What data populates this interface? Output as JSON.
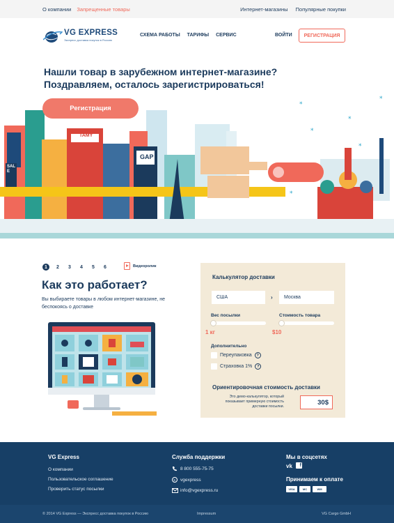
{
  "topbar": {
    "about": "О компании",
    "forbidden": "Запрещенные товары",
    "shops": "Интернет-магазины",
    "popular": "Популярные покупки"
  },
  "header": {
    "logo_title": "VG EXPRESS",
    "logo_subtitle": "Экспресс доставка покупок в Россию",
    "nav": [
      "СХЕМА РАБОТЫ",
      "ТАРИФЫ",
      "СЕРВИС"
    ],
    "login": "ВОЙТИ",
    "register": "РЕГИСТРАЦИЯ"
  },
  "hero": {
    "title_line1": "Нашли товар в зарубежном интернет-магазине?",
    "title_line2": "Поздравляем, осталось зарегистрироваться!",
    "button": "Регистрация",
    "sign_sale": "SALE",
    "sign_gap": "GAP",
    "sign_tamy": "TAMY"
  },
  "how": {
    "steps": [
      "1",
      "2",
      "3",
      "4",
      "5",
      "6"
    ],
    "active_step": "1",
    "video_label": "Видеоролик",
    "title": "Как это работает?",
    "text": "Вы выбираете товары в любом интернет-магазине, не беспокоясь о доставке"
  },
  "calculator": {
    "title": "Калькулятор доставки",
    "from": "США",
    "to": "Москва",
    "weight_label": "Вес посылки",
    "weight_value": "1 кг",
    "weight_fraction": 0.0,
    "cost_label": "Стоимость товара",
    "cost_value": "$10",
    "cost_fraction": 0.0,
    "extra_label": "Дополнительно",
    "repack": "Переупаковка",
    "insurance": "Страховка 1%",
    "help": "?",
    "estimate_title": "Ориентировочная стоимость доставки",
    "estimate_note": "Это демо-калькулятор, который показывает примерную стоимость доставки посылки.",
    "estimate_price": "30$"
  },
  "footer": {
    "col1_title": "VG Express",
    "col1_links": [
      "О компании",
      "Пользовательское соглашение",
      "Проверить статус посылки"
    ],
    "col2_title": "Служба поддержки",
    "phone": "8 800 555-75-75",
    "skype": "vgexpress",
    "email": "info@vgexpress.ru",
    "social_title": "Мы в соцсетях",
    "payment_title": "Принимаем к оплате",
    "payment_marks": [
      "VISA",
      "MC",
      "WM"
    ],
    "copyright": "© 2014 VG Express — Экспресс доставка покупок в Россию",
    "impressum": "Impressum",
    "company": "VG Cargo GmbH"
  },
  "colors": {
    "navy": "#1b3a5c",
    "accent": "#f0695a",
    "footer": "#173f66",
    "calc_bg": "#f3ead8"
  }
}
